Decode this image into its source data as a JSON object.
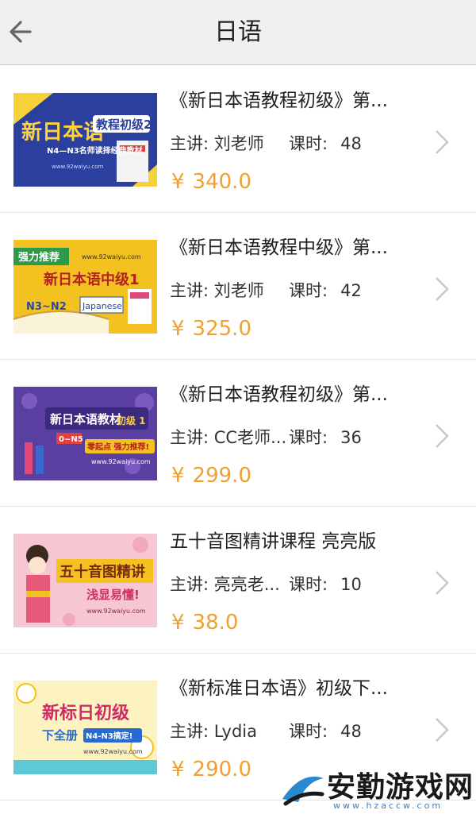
{
  "header": {
    "title": "日语",
    "back_icon": "back-arrow-icon"
  },
  "labels": {
    "teacher_prefix": "主讲: ",
    "hours_label": "课时:",
    "currency": "¥"
  },
  "courses": [
    {
      "title": "《新日本语教程初级》第...",
      "teacher": "刘老师",
      "hours": "48",
      "price": "340.0",
      "thumb": {
        "line1": "新日本语",
        "line2": "教程初级2",
        "line3": "N4—N3名师读择经典教材",
        "url": "www.92waiyu.com"
      }
    },
    {
      "title": "《新日本语教程中级》第...",
      "teacher": "刘老师",
      "hours": "42",
      "price": "325.0",
      "thumb": {
        "line1": "强力推荐",
        "line2": "新日本语中级1",
        "line3": "N3~N2",
        "line4": "Japanese",
        "url": "www.92waiyu.com"
      }
    },
    {
      "title": "《新日本语教程初级》第...",
      "teacher": "CC老师...",
      "hours": "36",
      "price": "299.0",
      "thumb": {
        "line1": "新日本语教材",
        "line2": "初级 1",
        "line3": "0~N5",
        "line4": "零起点 强力推荐!",
        "url": "www.92waiyu.com"
      }
    },
    {
      "title": "五十音图精讲课程 亮亮版",
      "teacher": "亮亮老...",
      "hours": "10",
      "price": "38.0",
      "thumb": {
        "line1": "五十音图精讲",
        "line2": "浅显易懂!",
        "url": "www.92waiyu.com"
      }
    },
    {
      "title": "《新标准日本语》初级下...",
      "teacher": "Lydia",
      "hours": "48",
      "price": "290.0",
      "thumb": {
        "line1": "新标日初级",
        "line2": "下全册",
        "line3": "N4-N3搞定!",
        "url": "www.92waiyu.com"
      }
    }
  ],
  "watermark": {
    "text": "安勤游戏网",
    "url": "www.hzaccw.com"
  },
  "colors": {
    "price": "#f0a030",
    "header_bg": "#f0f0f0",
    "divider": "#e2e2e2",
    "chevron": "#c8c8c8"
  }
}
